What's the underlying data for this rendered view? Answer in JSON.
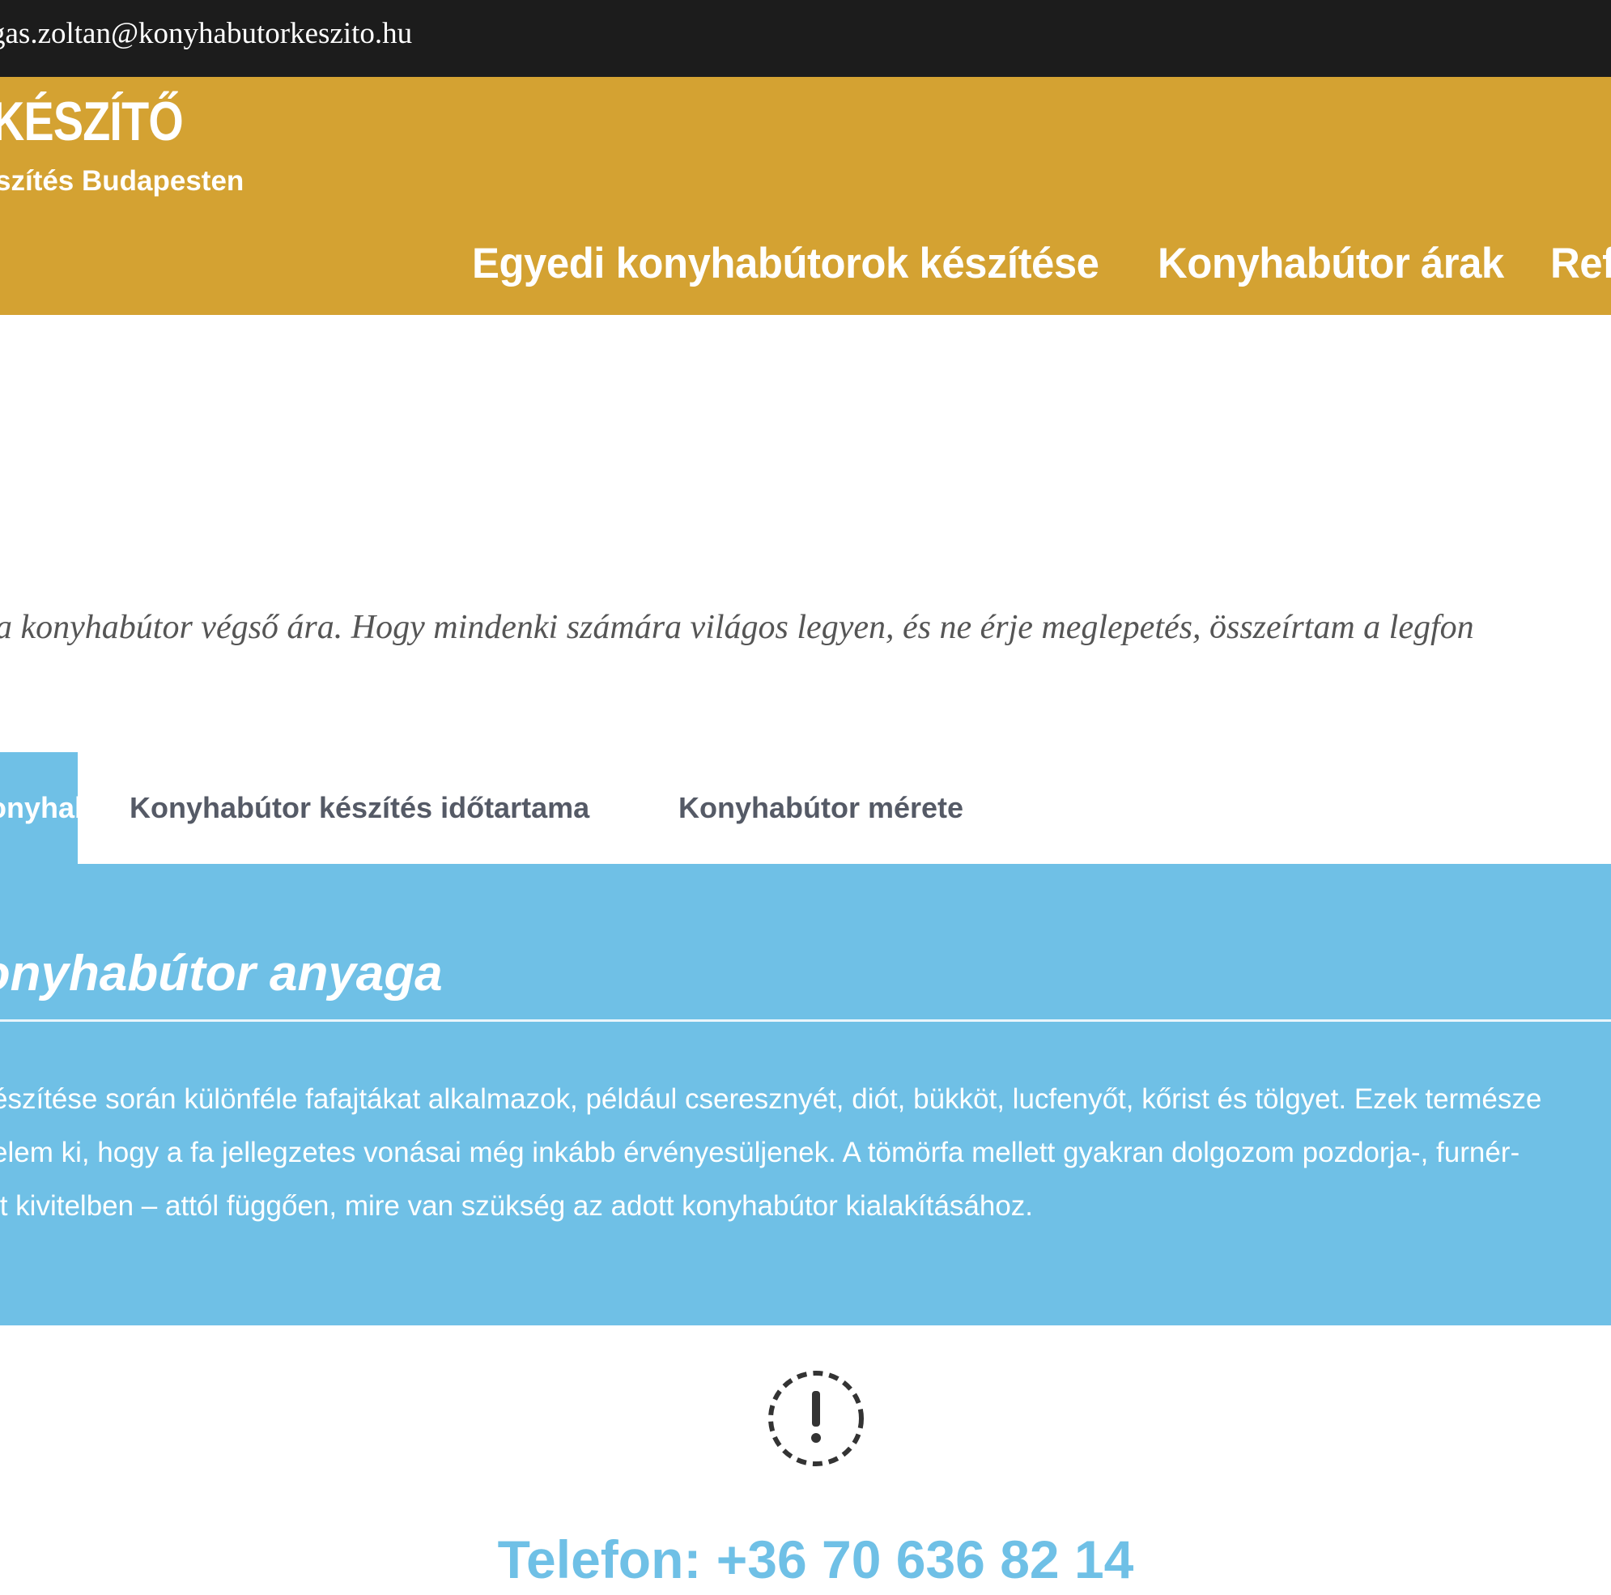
{
  "topbar": {
    "email": "gas.zoltan@konyhabutorkeszito.hu"
  },
  "header": {
    "logo_title": "KÉSZÍTŐ",
    "logo_subtitle": "szítés Budapesten",
    "nav": [
      {
        "label": "Egyedi konyhabútorok készítése"
      },
      {
        "label": "Konyhabútor árak"
      },
      {
        "label": "Refe"
      }
    ]
  },
  "intro": {
    "text": "a konyhabútor végső ára. Hogy mindenki számára világos legyen, és ne érje meglepetés, összeírtam a legfon"
  },
  "tabs": [
    {
      "label": "Konyhabútor anyaga",
      "active": true
    },
    {
      "label": "Konyhabútor készítés időtartama",
      "active": false
    },
    {
      "label": "Konyhabútor mérete",
      "active": false
    }
  ],
  "panel": {
    "heading": "Konyhabútor anyaga",
    "paragraph_lines": [
      "észítése során különféle fafajtákat alkalmazok, például cseresznyét, diót, bükköt, lucfenyőt, kőrist és tölgyet. Ezek természe",
      "elem ki, hogy a fa jellegzetes vonásai még inkább érvényesüljenek. A tömörfa mellett gyakran dolgozom pozdorja-, furnér-",
      "tt kivitelben – attól függően, mire van szükség az adott konyhabútor kialakításához."
    ]
  },
  "contact": {
    "phone": "Telefon: +36 70 636 82 14"
  },
  "colors": {
    "topbar": "#1c1c1c",
    "header": "#d4a232",
    "accent_blue": "#6fc0e6",
    "tab_text": "#555a66"
  },
  "icons": {
    "warning": "exclamation-circle-dashed-icon"
  }
}
